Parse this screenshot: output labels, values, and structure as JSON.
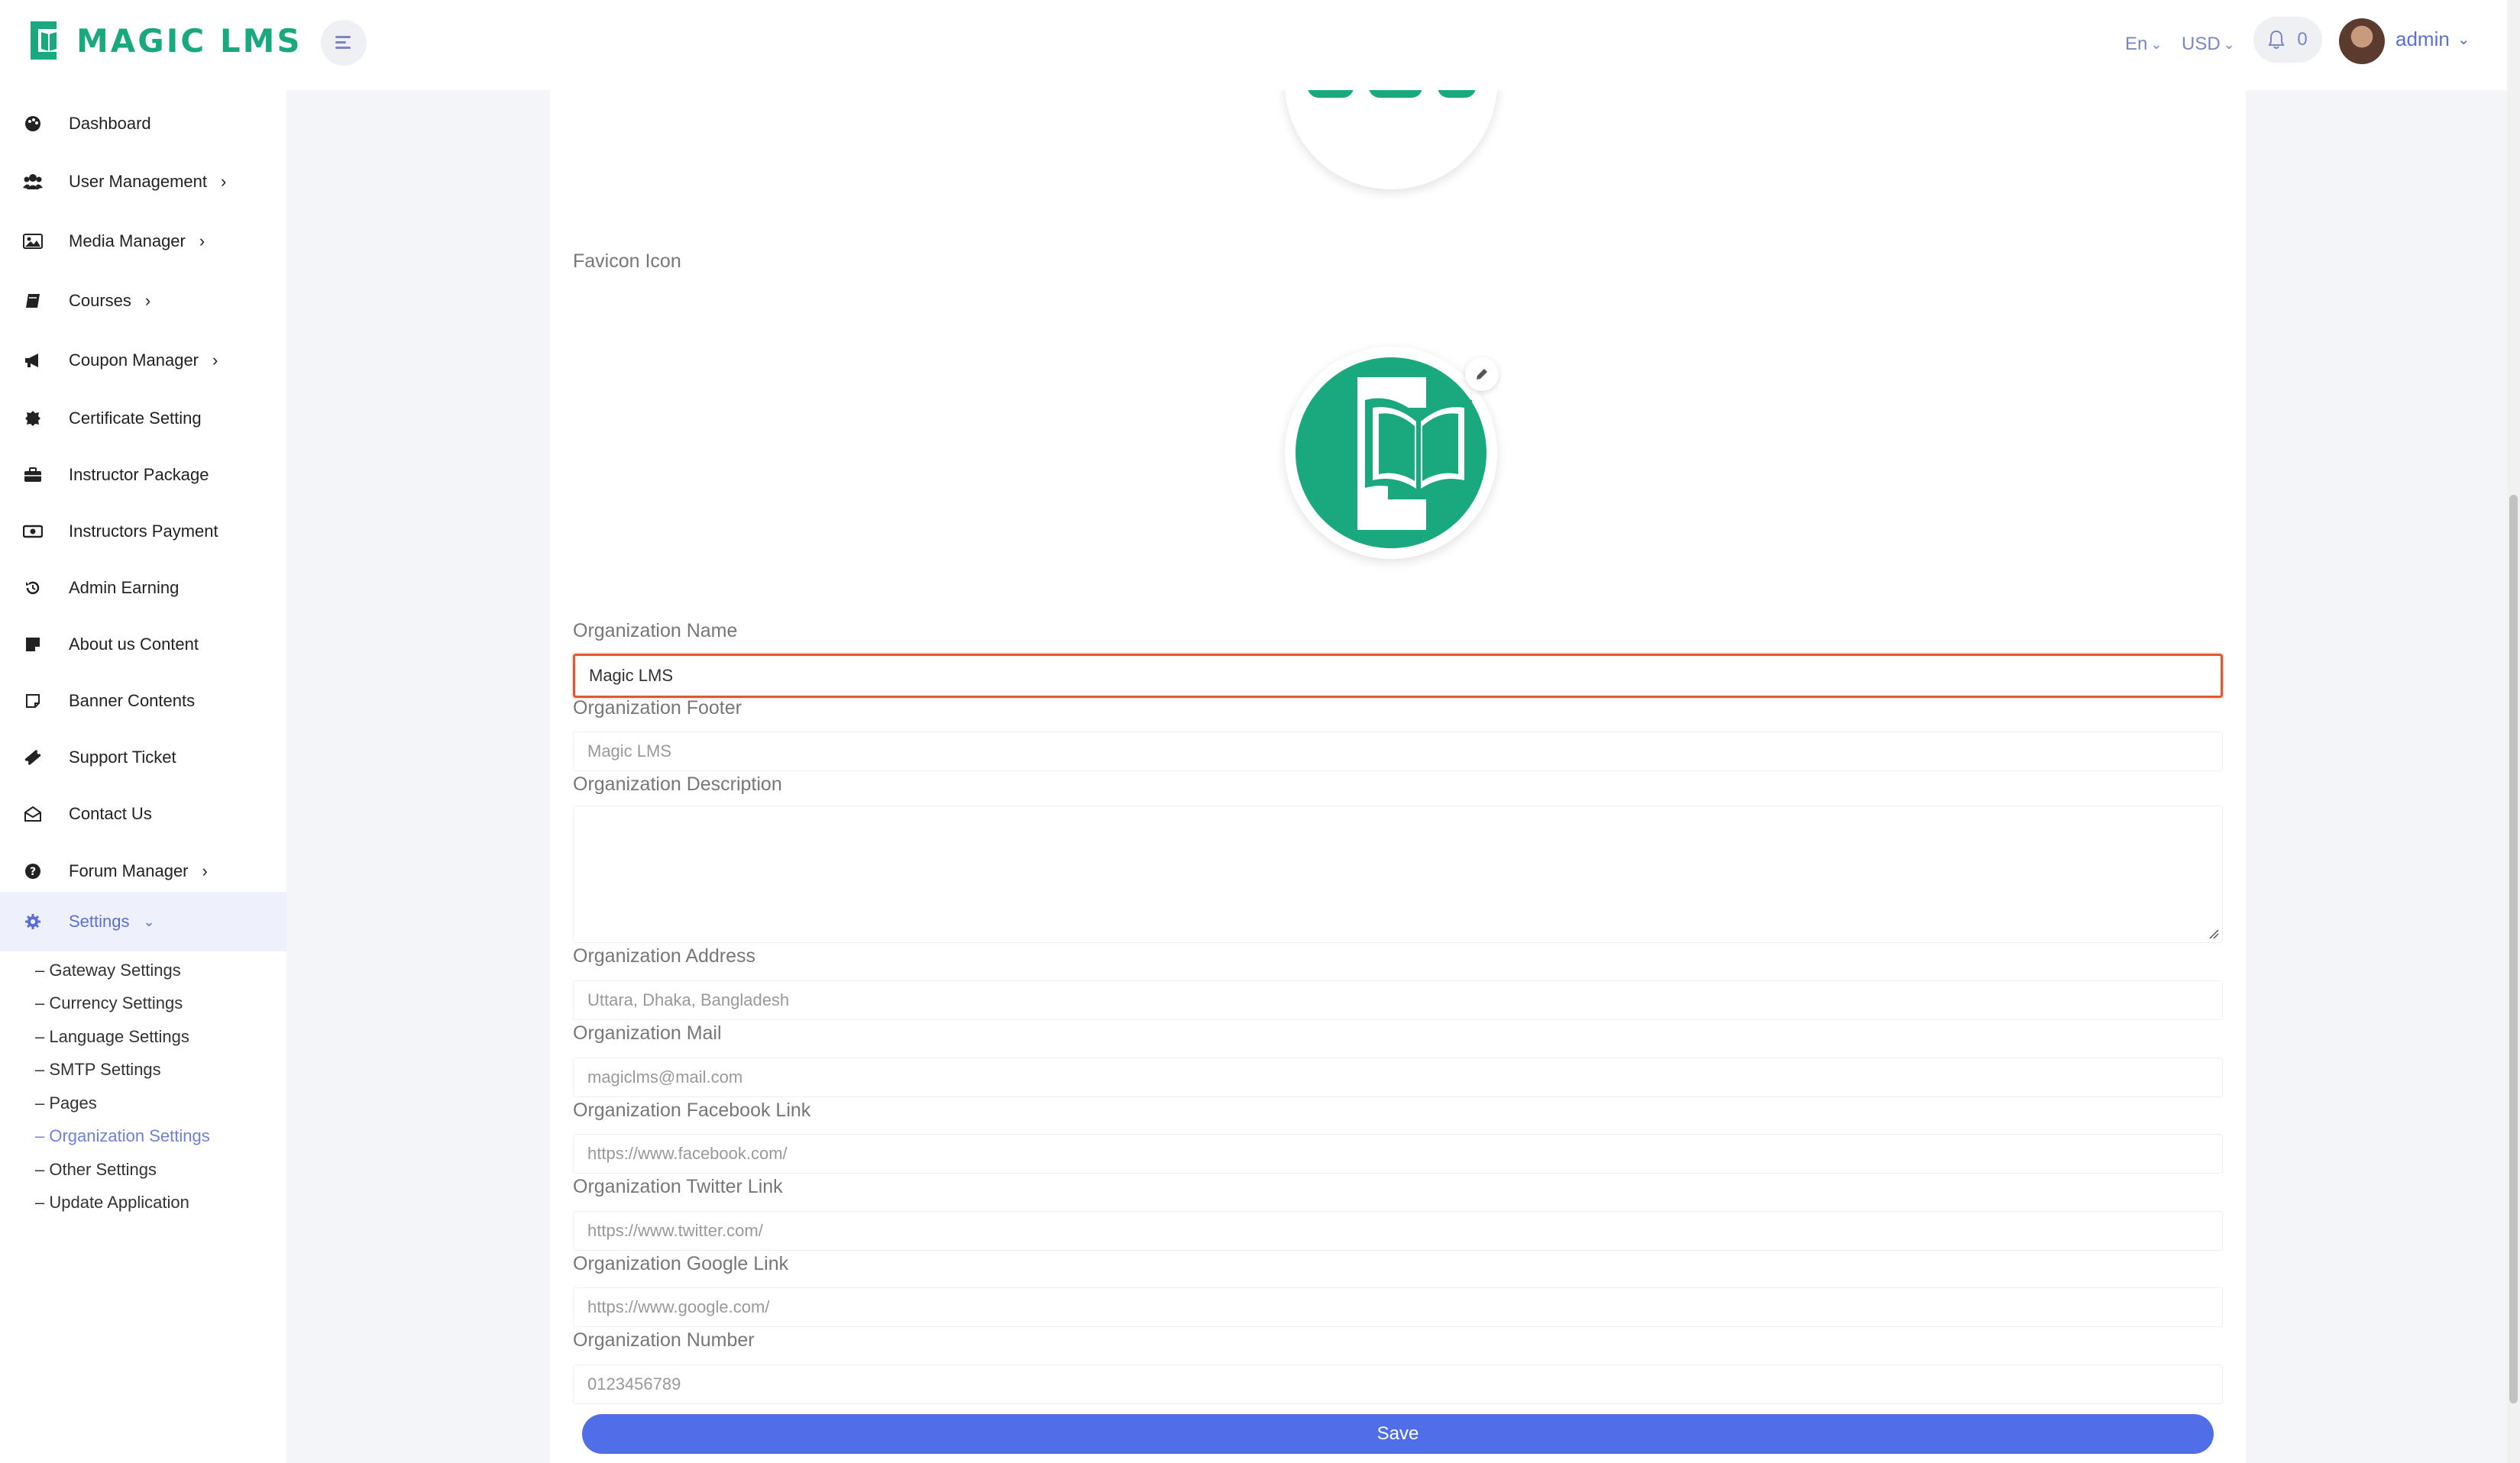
{
  "app": {
    "logo_text": "MAGIC LMS"
  },
  "header": {
    "language": "En",
    "currency": "USD",
    "notification_count": "0",
    "user_name": "admin"
  },
  "sidebar": {
    "items": [
      {
        "label": "Dashboard",
        "icon": "palette-icon"
      },
      {
        "label": "User Management",
        "icon": "users-icon",
        "has_submenu": true
      },
      {
        "label": "Media Manager",
        "icon": "image-icon",
        "has_submenu": true
      },
      {
        "label": "Courses",
        "icon": "book-icon",
        "has_submenu": true
      },
      {
        "label": "Coupon Manager",
        "icon": "megaphone-icon",
        "has_submenu": true
      },
      {
        "label": "Certificate Setting",
        "icon": "certificate-icon"
      },
      {
        "label": "Instructor Package",
        "icon": "briefcase-icon"
      },
      {
        "label": "Instructors Payment",
        "icon": "money-icon"
      },
      {
        "label": "Admin Earning",
        "icon": "history-icon"
      },
      {
        "label": "About us Content",
        "icon": "note-icon"
      },
      {
        "label": "Banner Contents",
        "icon": "sticky-note-icon"
      },
      {
        "label": "Support Ticket",
        "icon": "ticket-icon"
      },
      {
        "label": "Contact Us",
        "icon": "envelope-open-icon"
      },
      {
        "label": "Forum Manager",
        "icon": "question-circle-icon",
        "has_submenu": true
      },
      {
        "label": "Settings",
        "icon": "gear-icon",
        "has_submenu": true,
        "active": true
      }
    ],
    "settings_submenu": [
      "– Gateway Settings",
      "– Currency Settings",
      "– Language Settings",
      "– SMTP Settings",
      "– Pages",
      "– Organization Settings",
      "– Other Settings",
      "– Update Application"
    ],
    "active_submenu_index": 5
  },
  "form": {
    "favicon_label": "Favicon Icon",
    "fields": {
      "org_name": {
        "label": "Organization Name",
        "value": "Magic LMS"
      },
      "org_footer": {
        "label": "Organization Footer",
        "placeholder": "Magic LMS"
      },
      "org_description": {
        "label": "Organization Description",
        "value": ""
      },
      "org_address": {
        "label": "Organization Address",
        "placeholder": "Uttara, Dhaka, Bangladesh"
      },
      "org_mail": {
        "label": "Organization Mail",
        "placeholder": "magiclms@mail.com"
      },
      "org_facebook": {
        "label": "Organization Facebook Link",
        "placeholder": "https://www.facebook.com/"
      },
      "org_twitter": {
        "label": "Organization Twitter Link",
        "placeholder": "https://www.twitter.com/"
      },
      "org_google": {
        "label": "Organization Google Link",
        "placeholder": "https://www.google.com/"
      },
      "org_number": {
        "label": "Organization Number",
        "placeholder": "0123456789"
      }
    },
    "save_label": "Save"
  },
  "colors": {
    "brand_green": "#1aa97e",
    "accent_blue": "#4f6ee8",
    "focus_border": "#e4572e",
    "active_nav": "#5b6fd6"
  }
}
